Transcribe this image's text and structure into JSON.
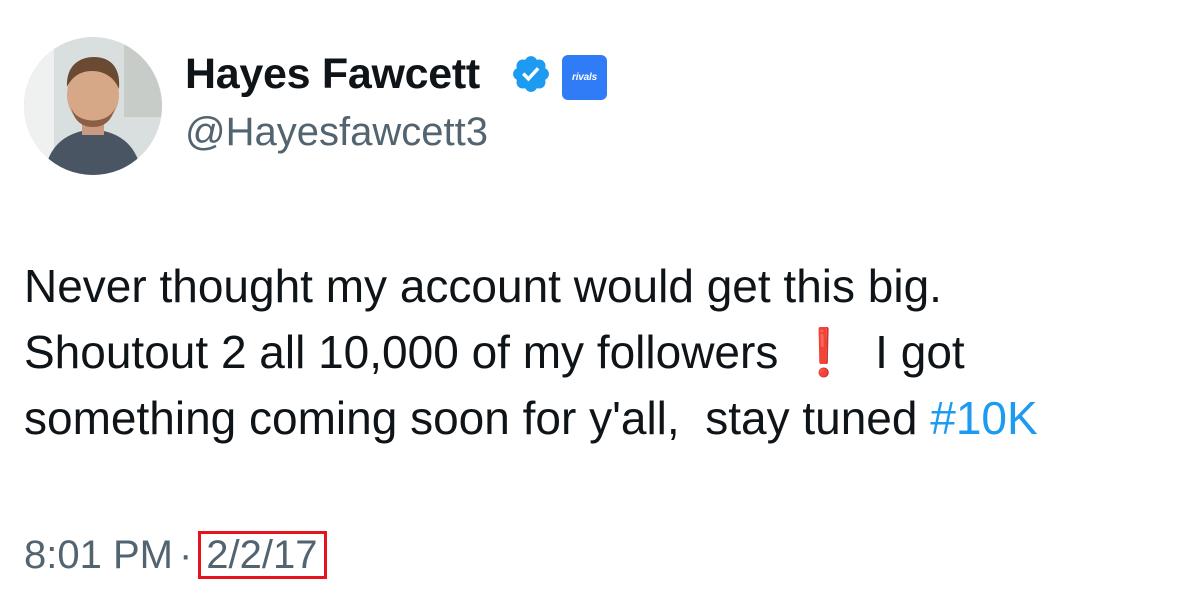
{
  "user": {
    "display_name": "Hayes Fawcett",
    "handle": "@Hayesfawcett3",
    "verified_icon": "verified-badge-icon",
    "affiliation_badge": "rivals"
  },
  "tweet": {
    "line1": "Never thought my account would get this big.",
    "line2_a": "Shoutout 2 all 10,000 of my followers",
    "line2_emoji": "❗",
    "line2_b": "I got",
    "line3_a": "something coming soon for y'all,  stay tuned ",
    "hashtag": "#10K"
  },
  "meta": {
    "time": "8:01 PM",
    "separator": "·",
    "date": "2/2/17"
  },
  "colors": {
    "link": "#1d9bf0",
    "verified": "#1d9bf0",
    "affiliation_bg": "#2f7cf6",
    "highlight_box": "#e5141c",
    "secondary_text": "#536471"
  }
}
